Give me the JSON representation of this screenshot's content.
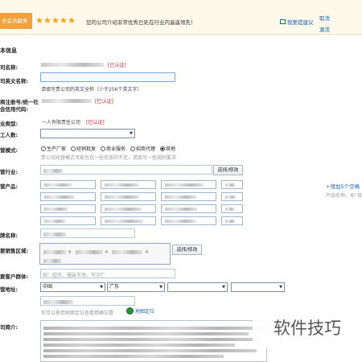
{
  "top": {
    "left_tab": "合会员服务",
    "message": "您的公司介绍非常优秀已处在行业内遥遥领先！",
    "feedback": "我要提建议",
    "side_links": [
      "取消",
      "激活"
    ]
  },
  "section": {
    "title": "本信息"
  },
  "labels": {
    "company_name": "司名称:",
    "english_name": "司英文名称:",
    "reg_no": "商注册号/统一社会信用代码:",
    "enterprise_type": "业类型:",
    "employees": "工人数:",
    "business_mode": "营模式:",
    "industry": "营行业:",
    "products": "营产品:",
    "brand": "牌名称:",
    "sales_area": "要销售区域:",
    "customers": "要客户群体:",
    "address": "营地址:",
    "intro": "司简介:"
  },
  "form": {
    "english_hint": "请填写贵公司的英文全称（少于256个英文字）",
    "verified": "[已认证]",
    "enterprise_type_value": "一人有限责任公司",
    "employees_value": "",
    "radios": [
      "生产厂家",
      "经销批发",
      "商业服务",
      "招商代理",
      "其他"
    ],
    "mode_hint": "贵公司经营模式可能包括一些信息的不足，请填写一些规则要求",
    "select_button": "选择/修改",
    "add_empty": "+增加5个空格",
    "product_example": "产品名称，如“官",
    "customers_placeholder": "如：超市、服装市场、写字厂",
    "address": {
      "country": "中国",
      "province": "广东",
      "city": "",
      "district": ""
    },
    "map_hint": "你可以使用地图定位查看精确位置",
    "map_button": "地图定位"
  },
  "watermark": "软件技巧",
  "colors": {
    "accent": "#1d62b1",
    "warning": "#d01f1f",
    "tab_orange": "#f1a13b",
    "star_gold": "#f3a313"
  }
}
